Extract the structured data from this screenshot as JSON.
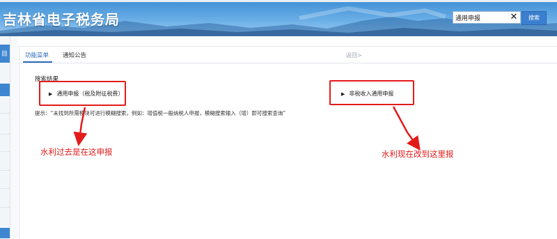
{
  "header": {
    "site_title": "吉林省电子税务局",
    "search": {
      "value": "通用申报",
      "clear_icon": "close-icon",
      "button_label": "搜索"
    }
  },
  "leftnav": {
    "tab_label": "目"
  },
  "tabs": [
    {
      "label": "功能菜单",
      "active": true
    },
    {
      "label": "通知公告",
      "active": false
    }
  ],
  "back_link": "返回>",
  "results": {
    "title": "搜索结果",
    "items": [
      {
        "label": "通用申报（税及附征税费）",
        "icon": "triangle-right-icon"
      },
      {
        "label": "非税收入通用申报",
        "icon": "triangle-right-icon"
      }
    ],
    "tip": "提示：“未找到所需模块可进行模糊搜索，例如：增值税一般纳税人申报，模糊搜索输入（增）即可搜索查询”"
  },
  "annotations": {
    "left_note": "水利过去是在这申报",
    "right_note": "水利现在改到这里报",
    "color": "#e21b1b"
  },
  "colors": {
    "accent": "#2d6db8",
    "header_blue": "#3f8fd6",
    "search_button": "#3b7fd0"
  }
}
